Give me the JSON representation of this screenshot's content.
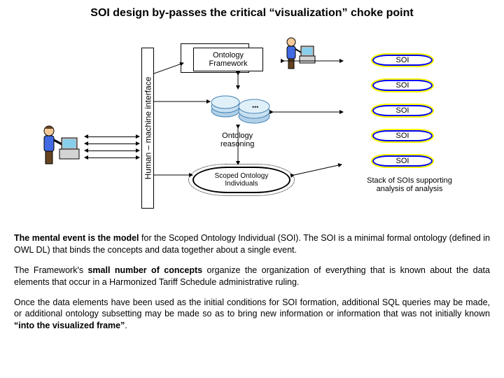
{
  "title": "SOI design by-passes the critical “visualization” choke point",
  "hmi": "Human – machine interface",
  "of_box": "Ontology\nFramework",
  "or_label": "Ontology\nreasoning",
  "soi_oval": "Scoped Ontology\nIndividuals",
  "soi": "SOI",
  "stack_caption": "Stack of SOIs supporting analysis of analysis",
  "p1_a": "The mental event is the model",
  "p1_b": " for the Scoped Ontology Individual (SOI). The SOI is a minimal formal ontology (defined in OWL DL) that binds the concepts and data together about a single event.",
  "p2_a": "The Framework's ",
  "p2_b": "small number of concepts",
  "p2_c": " organize the organization of everything that is known about the data elements that occur in a Harmonized Tariff Schedule administrative ruling.",
  "p3_a": "Once the data elements have been used as the initial conditions for SOI formation, additional SQL queries may be made, or additional ontology subsetting may be made so as to bring new information or information that was not initially known ",
  "p3_b": "“into the visualized frame”",
  "p3_c": "."
}
